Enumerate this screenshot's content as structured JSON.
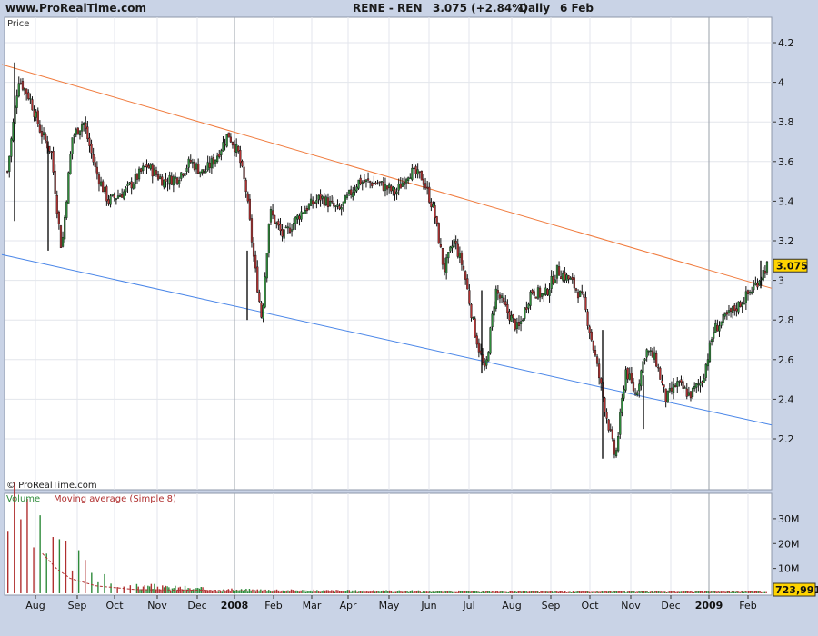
{
  "header": {
    "site": "www.ProRealTime.com",
    "instrument": "RENE - REN",
    "quote": "3.075 (+2.84%)",
    "period": "Daily",
    "date": "6 Feb"
  },
  "price_panel": {
    "label": "Price",
    "watermark": "© ProRealTime.com"
  },
  "volume_panel": {
    "label_volume": "Volume",
    "label_ma": "Moving average (Simple 8)"
  },
  "colors": {
    "up": "#2e8b3a",
    "down": "#b03030",
    "upper_trend": "#f07a3c",
    "lower_trend": "#4a86e8",
    "badge": "#ffd400",
    "background": "#c9d3e6"
  },
  "chart_data": [
    {
      "type": "candlestick",
      "title": "RENE - REN",
      "ylabel": "Price",
      "ylim": [
        2.0,
        4.3
      ],
      "yticks": [
        2.2,
        2.4,
        2.6,
        2.8,
        3,
        3.2,
        3.4,
        3.6,
        3.8,
        4,
        4.2
      ],
      "grid": true,
      "x_labels": [
        {
          "label": "Aug",
          "bold": false
        },
        {
          "label": "Sep",
          "bold": false
        },
        {
          "label": "Oct",
          "bold": false
        },
        {
          "label": "Nov",
          "bold": false
        },
        {
          "label": "Dec",
          "bold": false
        },
        {
          "label": "2008",
          "bold": true
        },
        {
          "label": "Feb",
          "bold": false
        },
        {
          "label": "Mar",
          "bold": false
        },
        {
          "label": "Apr",
          "bold": false
        },
        {
          "label": "May",
          "bold": false
        },
        {
          "label": "Jun",
          "bold": false
        },
        {
          "label": "Jul",
          "bold": false
        },
        {
          "label": "Aug",
          "bold": false
        },
        {
          "label": "Sep",
          "bold": false
        },
        {
          "label": "Oct",
          "bold": false
        },
        {
          "label": "Nov",
          "bold": false
        },
        {
          "label": "Dec",
          "bold": false
        },
        {
          "label": "2009",
          "bold": true
        },
        {
          "label": "Feb",
          "bold": false
        }
      ],
      "last_price_label": "3.075",
      "last_price": 3.075,
      "trendlines": [
        {
          "name": "upper",
          "start": [
            "Jul 2007",
            4.09
          ],
          "end": [
            "Feb 2009",
            2.96
          ]
        },
        {
          "name": "lower",
          "start": [
            "Jul 2007",
            3.13
          ],
          "end": [
            "Feb 2009",
            2.27
          ]
        }
      ],
      "close_path": [
        [
          "Jul 2007",
          3.55
        ],
        [
          "Jul 2007",
          4.02
        ],
        [
          "Jul 2007",
          3.92
        ],
        [
          "Aug 2007",
          3.75
        ],
        [
          "Aug 2007",
          3.65
        ],
        [
          "Aug 2007",
          3.15
        ],
        [
          "Aug 2007",
          3.72
        ],
        [
          "Sep 2007",
          3.8
        ],
        [
          "Sep 2007",
          3.55
        ],
        [
          "Sep 2007",
          3.4
        ],
        [
          "Oct 2007",
          3.45
        ],
        [
          "Oct 2007",
          3.58
        ],
        [
          "Nov 2007",
          3.5
        ],
        [
          "Nov 2007",
          3.52
        ],
        [
          "Nov 2007",
          3.6
        ],
        [
          "Dec 2007",
          3.54
        ],
        [
          "Dec 2007",
          3.62
        ],
        [
          "Dec 2007",
          3.74
        ],
        [
          "Jan 2008",
          3.64
        ],
        [
          "Jan 2008",
          3.45
        ],
        [
          "Jan 2008",
          3.1
        ],
        [
          "Jan 2008",
          2.8
        ],
        [
          "Jan 2008",
          3.35
        ],
        [
          "Feb 2008",
          3.22
        ],
        [
          "Feb 2008",
          3.35
        ],
        [
          "Mar 2008",
          3.42
        ],
        [
          "Mar 2008",
          3.35
        ],
        [
          "Apr 2008",
          3.5
        ],
        [
          "Apr 2008",
          3.49
        ],
        [
          "May 2008",
          3.44
        ],
        [
          "May 2008",
          3.55
        ],
        [
          "May 2008",
          3.52
        ],
        [
          "Jun 2008",
          3.35
        ],
        [
          "Jun 2008",
          3.05
        ],
        [
          "Jun 2008",
          3.2
        ],
        [
          "Jun 2008",
          3.05
        ],
        [
          "Jul 2008",
          2.75
        ],
        [
          "Jul 2008",
          2.53
        ],
        [
          "Jul 2008",
          2.95
        ],
        [
          "Jul 2008",
          2.85
        ],
        [
          "Aug 2008",
          2.75
        ],
        [
          "Aug 2008",
          2.95
        ],
        [
          "Aug 2008",
          2.92
        ],
        [
          "Sep 2008",
          3.05
        ],
        [
          "Sep 2008",
          3.0
        ],
        [
          "Sep 2008",
          2.9
        ],
        [
          "Oct 2008",
          2.62
        ],
        [
          "Oct 2008",
          2.35
        ],
        [
          "Oct 2008",
          2.1
        ],
        [
          "Oct 2008",
          2.55
        ],
        [
          "Nov 2008",
          2.42
        ],
        [
          "Nov 2008",
          2.65
        ],
        [
          "Nov 2008",
          2.6
        ],
        [
          "Nov 2008",
          2.4
        ],
        [
          "Dec 2008",
          2.48
        ],
        [
          "Dec 2008",
          2.42
        ],
        [
          "Dec 2008",
          2.5
        ],
        [
          "Jan 2009",
          2.75
        ],
        [
          "Jan 2009",
          2.8
        ],
        [
          "Jan 2009",
          2.85
        ],
        [
          "Jan 2009",
          2.9
        ],
        [
          "Feb 2009",
          2.97
        ],
        [
          "Feb 2009",
          3.075
        ]
      ],
      "spikes": [
        {
          "date": "Jul 2007",
          "low": 3.3,
          "high": 4.1
        },
        {
          "date": "Aug 2007",
          "low": 3.15,
          "high": 3.7
        },
        {
          "date": "Jan 2008",
          "low": 2.8,
          "high": 3.15
        },
        {
          "date": "Jul 2008",
          "low": 2.53,
          "high": 2.95
        },
        {
          "date": "Oct 2008",
          "low": 2.1,
          "high": 2.75
        },
        {
          "date": "Nov 2008",
          "low": 2.25,
          "high": 2.52
        },
        {
          "date": "Feb 2009",
          "low": 2.96,
          "high": 3.1
        }
      ]
    },
    {
      "type": "bar",
      "title": "Volume",
      "ylim": [
        0,
        38000000
      ],
      "yticks": [
        {
          "value": 10000000,
          "label": "10M"
        },
        {
          "value": 20000000,
          "label": "20M"
        },
        {
          "value": 30000000,
          "label": "30M"
        }
      ],
      "last_volume_label": "723,991",
      "last_volume": 723991,
      "series": [
        {
          "name": "Volume",
          "values": [
            [
              36000000,
              30000000,
              25000000,
              22000000,
              18000000,
              15000000,
              12000000,
              9000000,
              6000000,
              4000000
            ],
            [
              3000000,
              3000000,
              2500000,
              2500000,
              2000000,
              2000000,
              1500000,
              1500000,
              1500000,
              1500000
            ],
            [
              1500000,
              1300000,
              1300000,
              1200000,
              1200000,
              1200000,
              1100000,
              1100000,
              1000000,
              1000000
            ],
            [
              1000000,
              1000000,
              900000,
              900000,
              900000,
              900000,
              800000,
              800000,
              800000,
              800000
            ],
            [
              800000,
              800000,
              800000,
              700000,
              700000,
              700000,
              700000,
              700000,
              700000,
              700000
            ],
            [
              700000,
              700000,
              700000,
              700000,
              700000,
              700000,
              700000,
              700000,
              723991
            ]
          ]
        },
        {
          "name": "Moving average (Simple 8)",
          "values": [
            [
              "Aug 2007",
              16000000
            ],
            [
              "Aug 2007",
              10000000
            ],
            [
              "Aug 2007",
              6000000
            ],
            [
              "Sep 2007",
              3000000
            ],
            [
              "Oct 2007",
              1500000
            ],
            [
              "Jan 2008",
              1000000
            ],
            [
              "Jun 2008",
              800000
            ],
            [
              "Feb 2009",
              700000
            ]
          ]
        }
      ]
    }
  ]
}
